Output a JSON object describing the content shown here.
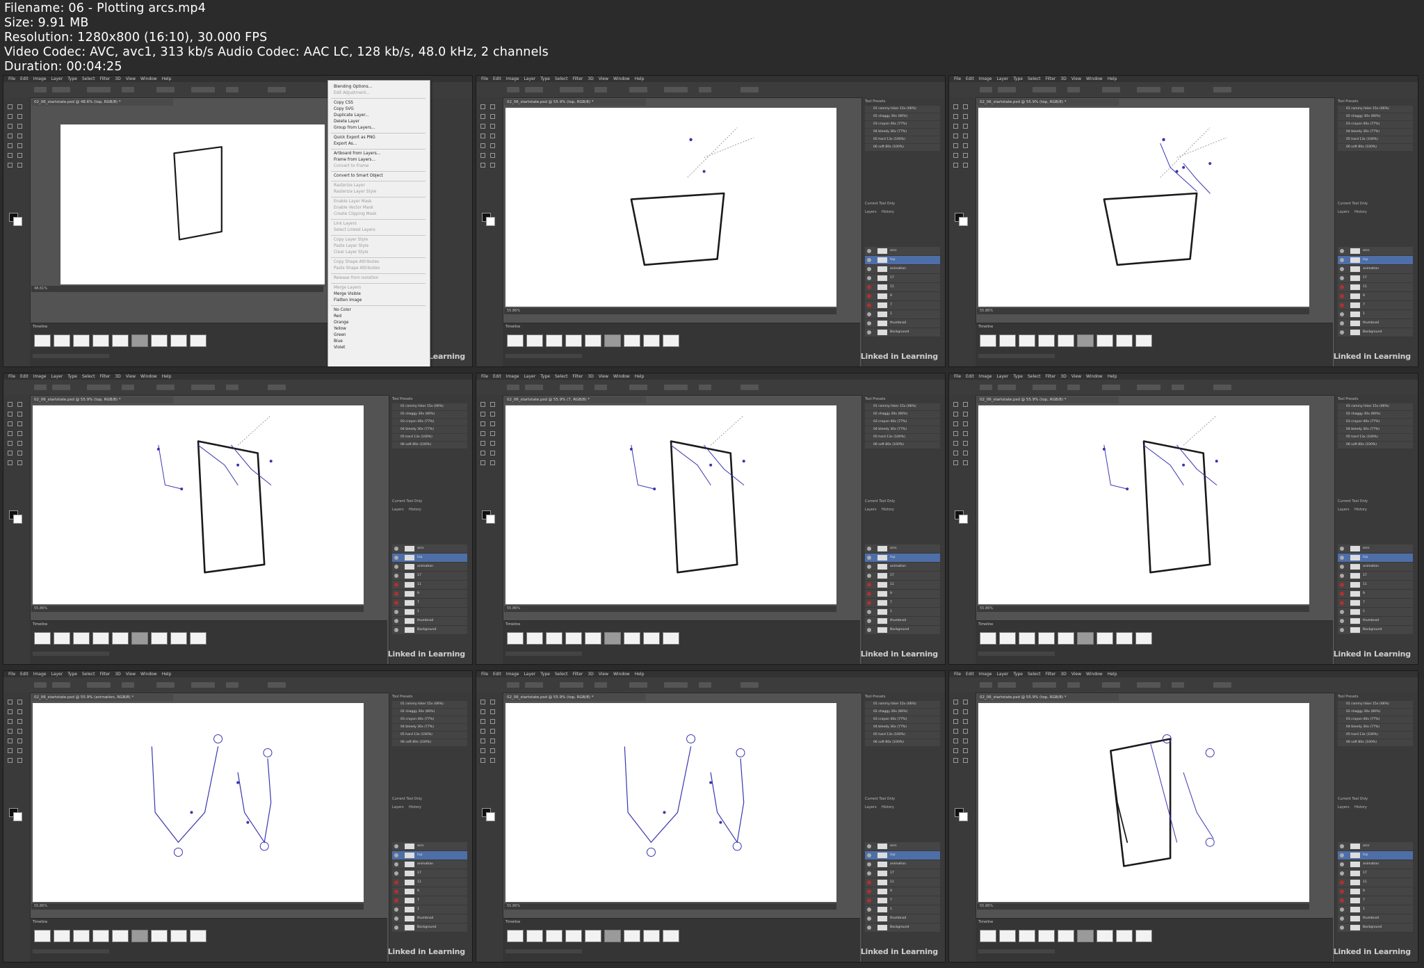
{
  "header": {
    "filename": "Filename: 06 - Plotting arcs.mp4",
    "size": "Size: 9.91 MB",
    "resolution": "Resolution: 1280x800 (16:10), 30.000 FPS",
    "codec": "Video Codec: AVC, avc1, 313 kb/s Audio Codec: AAC LC, 128 kb/s, 48.0 kHz, 2 channels",
    "duration": "Duration: 00:04:25"
  },
  "menu_items": [
    "File",
    "Edit",
    "Image",
    "Layer",
    "Type",
    "Select",
    "Filter",
    "3D",
    "View",
    "Window",
    "Help"
  ],
  "tiles": [
    {
      "doc": "02_06_startstate.psd @ 48.6% (top, RGB/8) *",
      "status": "48.61%",
      "scene": "menu"
    },
    {
      "doc": "02_06_startstate.psd @ 55.9% (top, RGB/8) *",
      "status": "55.86%",
      "scene": "s2"
    },
    {
      "doc": "02_06_startstate.psd @ 55.9% (top, RGB/8) *",
      "status": "55.86%",
      "scene": "s3"
    },
    {
      "doc": "02_06_startstate.psd @ 55.9% (top, RGB/8) *",
      "status": "55.86%",
      "scene": "s4"
    },
    {
      "doc": "02_06_startstate.psd @ 55.9% (7, RGB/8) *",
      "status": "55.86%",
      "scene": "s5"
    },
    {
      "doc": "02_06_startstate.psd @ 55.9% (top, RGB/8) *",
      "status": "55.86%",
      "scene": "s6"
    },
    {
      "doc": "02_06_startstate.psd @ 55.9% (animation, RGB/8) *",
      "status": "55.86%",
      "scene": "s7"
    },
    {
      "doc": "02_06_startstate.psd @ 55.9% (top, RGB/8) *",
      "status": "55.86%",
      "scene": "s8"
    },
    {
      "doc": "02_06_startstate.psd @ 55.9% (top, RGB/8) *",
      "status": "55.86%",
      "scene": "s9"
    }
  ],
  "context_menu": [
    {
      "label": "Blending Options...",
      "dim": false
    },
    {
      "label": "Edit Adjustment...",
      "dim": true
    },
    {
      "label": "Copy CSS",
      "dim": false
    },
    {
      "label": "Copy SVG",
      "dim": false
    },
    {
      "label": "Duplicate Layer...",
      "dim": false
    },
    {
      "label": "Delete Layer",
      "dim": false
    },
    {
      "label": "Group from Layers...",
      "dim": false
    },
    {
      "label": "Quick Export as PNG",
      "dim": false
    },
    {
      "label": "Export As...",
      "dim": false
    },
    {
      "label": "Artboard from Layers...",
      "dim": false
    },
    {
      "label": "Frame from Layers...",
      "dim": false
    },
    {
      "label": "Convert to Frame",
      "dim": true
    },
    {
      "label": "Convert to Smart Object",
      "dim": false
    },
    {
      "label": "Rasterize Layer",
      "dim": true
    },
    {
      "label": "Rasterize Layer Style",
      "dim": true
    },
    {
      "label": "Enable Layer Mask",
      "dim": true
    },
    {
      "label": "Enable Vector Mask",
      "dim": true
    },
    {
      "label": "Create Clipping Mask",
      "dim": true
    },
    {
      "label": "Link Layers",
      "dim": true
    },
    {
      "label": "Select Linked Layers",
      "dim": true
    },
    {
      "label": "Copy Layer Style",
      "dim": true
    },
    {
      "label": "Paste Layer Style",
      "dim": true
    },
    {
      "label": "Clear Layer Style",
      "dim": true
    },
    {
      "label": "Copy Shape Attributes",
      "dim": true
    },
    {
      "label": "Paste Shape Attributes",
      "dim": true
    },
    {
      "label": "Release from Isolation",
      "dim": true
    },
    {
      "label": "Merge Layers",
      "dim": true
    },
    {
      "label": "Merge Visible",
      "dim": false
    },
    {
      "label": "Flatten Image",
      "dim": false
    },
    {
      "label": "No Color",
      "dim": false
    },
    {
      "label": "Red",
      "dim": false
    },
    {
      "label": "Orange",
      "dim": false
    },
    {
      "label": "Yellow",
      "dim": false
    },
    {
      "label": "Green",
      "dim": false
    },
    {
      "label": "Blue",
      "dim": false
    },
    {
      "label": "Violet",
      "dim": false
    }
  ],
  "tool_presets": [
    "01 rammy hiker 15x (66%)",
    "02 shaggy 30x (66%)",
    "03 crayon 40x (77%)",
    "04 bleedy 30x (77%)",
    "05 hard 13x (100%)",
    "06 soft 80x (100%)"
  ],
  "panels": {
    "tool_presets_title": "Tool Presets",
    "current_tool_only": "Current Tool Only",
    "layers_tab": "Layers",
    "history_tab": "History",
    "timeline_label": "Timeline",
    "propagate": "Propagate Frame 1"
  },
  "layer_names": [
    "arcs",
    "top",
    "animation",
    "17",
    "11",
    "9",
    "7",
    "1",
    "thumbnail",
    "Background"
  ],
  "timeline_frames": [
    "1",
    "2",
    "3",
    "4",
    "5",
    "6",
    "7",
    "8",
    "9"
  ],
  "watermark": "Linked in Learning",
  "colors": {
    "stroke": "#1a1a1a",
    "arc": "#3a35b0",
    "ui_bg": "#535353",
    "panel": "#3a3a3a"
  }
}
